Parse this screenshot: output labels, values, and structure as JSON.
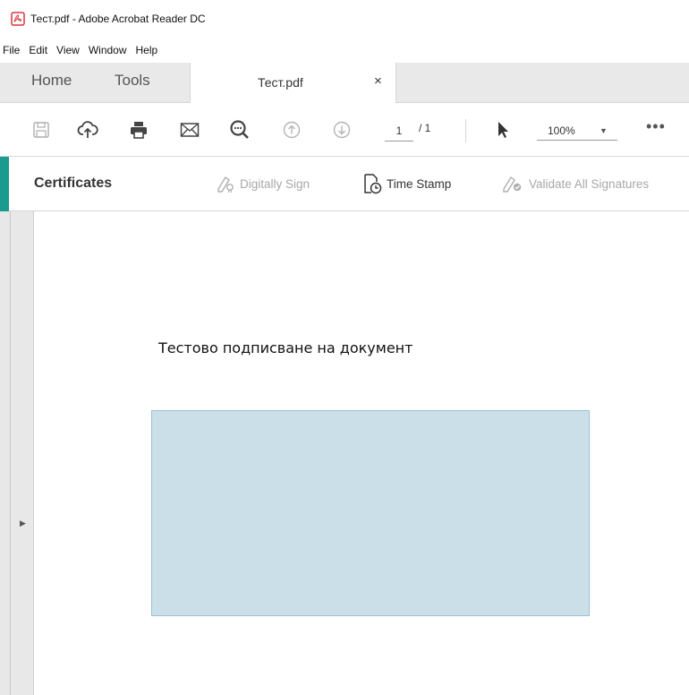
{
  "window": {
    "title": "Тест.pdf - Adobe Acrobat Reader DC",
    "icon": "pdf-icon"
  },
  "menu": [
    "File",
    "Edit",
    "View",
    "Window",
    "Help"
  ],
  "tabs": {
    "home": "Home",
    "tools": "Tools",
    "active": {
      "label": "Тест.pdf",
      "close": "×"
    }
  },
  "toolbar": {
    "icons": [
      "save-icon",
      "upload-icon",
      "print-icon",
      "email-icon",
      "zoom-search-icon",
      "page-up-icon",
      "page-down-icon",
      "select-arrow-icon"
    ],
    "page_current": "1",
    "page_total": "/ 1",
    "zoom": "100%",
    "more": "•••"
  },
  "certificates_bar": {
    "title": "Certificates",
    "actions": [
      {
        "label": "Digitally Sign",
        "enabled": false,
        "icon": "pen-sign-icon"
      },
      {
        "label": "Time Stamp",
        "enabled": true,
        "icon": "time-stamp-icon"
      },
      {
        "label": "Validate All Signatures",
        "enabled": false,
        "icon": "validate-icon"
      }
    ],
    "accent_color": "#1a9b8f"
  },
  "document": {
    "text": "Тестово подписване на документ",
    "signature_field_color": "#cbdfe9"
  }
}
